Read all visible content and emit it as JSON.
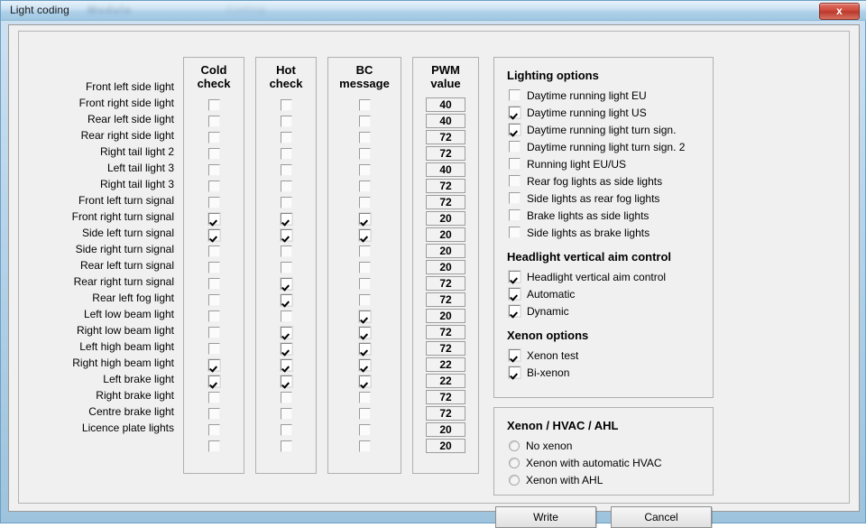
{
  "window": {
    "title": "Light coding",
    "ghost_text_1": "Module",
    "ghost_text_2": "Coding",
    "close_label": "x"
  },
  "columns": {
    "cold_check": "Cold\ncheck",
    "cold_check_line1": "Cold",
    "cold_check_line2": "check",
    "hot_check_line1": "Hot",
    "hot_check_line2": "check",
    "bc_message_line1": "BC",
    "bc_message_line2": "message",
    "pwm_value_line1": "PWM",
    "pwm_value_line2": "value"
  },
  "rows": [
    {
      "label": "Front left side light",
      "cold": false,
      "hot": false,
      "bc": false,
      "pwm": "40"
    },
    {
      "label": "Front right side light",
      "cold": false,
      "hot": false,
      "bc": false,
      "pwm": "40"
    },
    {
      "label": "Rear left side light",
      "cold": false,
      "hot": false,
      "bc": false,
      "pwm": "72"
    },
    {
      "label": "Rear right side light",
      "cold": false,
      "hot": false,
      "bc": false,
      "pwm": "72"
    },
    {
      "label": "Right tail light 2",
      "cold": false,
      "hot": false,
      "bc": false,
      "pwm": "40"
    },
    {
      "label": "Left tail light 3",
      "cold": false,
      "hot": false,
      "bc": false,
      "pwm": "72"
    },
    {
      "label": "Right tail light 3",
      "cold": false,
      "hot": false,
      "bc": false,
      "pwm": "72"
    },
    {
      "label": "Front left turn signal",
      "cold": true,
      "hot": true,
      "bc": true,
      "pwm": "20"
    },
    {
      "label": "Front right turn signal",
      "cold": true,
      "hot": true,
      "bc": true,
      "pwm": "20"
    },
    {
      "label": "Side left turn signal",
      "cold": false,
      "hot": false,
      "bc": false,
      "pwm": "20"
    },
    {
      "label": "Side right turn signal",
      "cold": false,
      "hot": false,
      "bc": false,
      "pwm": "20"
    },
    {
      "label": "Rear left turn signal",
      "cold": false,
      "hot": true,
      "bc": false,
      "pwm": "72"
    },
    {
      "label": "Rear right turn signal",
      "cold": false,
      "hot": true,
      "bc": false,
      "pwm": "72"
    },
    {
      "label": "Rear left fog light",
      "cold": false,
      "hot": false,
      "bc": true,
      "pwm": "20"
    },
    {
      "label": "Left low beam light",
      "cold": false,
      "hot": true,
      "bc": true,
      "pwm": "72"
    },
    {
      "label": "Right low beam light",
      "cold": false,
      "hot": true,
      "bc": true,
      "pwm": "72"
    },
    {
      "label": "Left high beam light",
      "cold": true,
      "hot": true,
      "bc": true,
      "pwm": "22"
    },
    {
      "label": "Right high beam light",
      "cold": true,
      "hot": true,
      "bc": true,
      "pwm": "22"
    },
    {
      "label": "Left brake light",
      "cold": false,
      "hot": false,
      "bc": false,
      "pwm": "72"
    },
    {
      "label": "Right brake light",
      "cold": false,
      "hot": false,
      "bc": false,
      "pwm": "72"
    },
    {
      "label": "Centre brake light",
      "cold": false,
      "hot": false,
      "bc": false,
      "pwm": "20"
    },
    {
      "label": "Licence plate lights",
      "cold": false,
      "hot": false,
      "bc": false,
      "pwm": "20"
    }
  ],
  "lighting_options": {
    "title": "Lighting options",
    "items": [
      {
        "label": "Daytime running light EU",
        "checked": false
      },
      {
        "label": "Daytime running light US",
        "checked": true
      },
      {
        "label": "Daytime running light turn sign.",
        "checked": true
      },
      {
        "label": "Daytime running light turn sign. 2",
        "checked": false
      },
      {
        "label": "Running light EU/US",
        "checked": false
      },
      {
        "label": "Rear fog lights as side lights",
        "checked": false
      },
      {
        "label": "Side lights as rear fog lights",
        "checked": false
      },
      {
        "label": "Brake lights as side lights",
        "checked": false
      },
      {
        "label": "Side lights as brake lights",
        "checked": false
      }
    ]
  },
  "headlight_aim": {
    "title": "Headlight vertical aim control",
    "items": [
      {
        "label": "Headlight vertical aim control",
        "checked": true
      },
      {
        "label": "Automatic",
        "checked": true
      },
      {
        "label": "Dynamic",
        "checked": true
      }
    ]
  },
  "xenon_options": {
    "title": "Xenon options",
    "items": [
      {
        "label": "Xenon test",
        "checked": true
      },
      {
        "label": "Bi-xenon",
        "checked": true
      }
    ]
  },
  "xenon_hvac_ahl": {
    "title": "Xenon / HVAC / AHL",
    "items": [
      {
        "label": "No xenon",
        "selected": false
      },
      {
        "label": "Xenon with automatic HVAC",
        "selected": false
      },
      {
        "label": "Xenon with AHL",
        "selected": false
      }
    ]
  },
  "buttons": {
    "write": "Write",
    "cancel": "Cancel"
  },
  "colors": {
    "titlebar_accent": "#aed0e8",
    "close_button": "#cd4536",
    "dialog_face": "#f0f0f0"
  }
}
